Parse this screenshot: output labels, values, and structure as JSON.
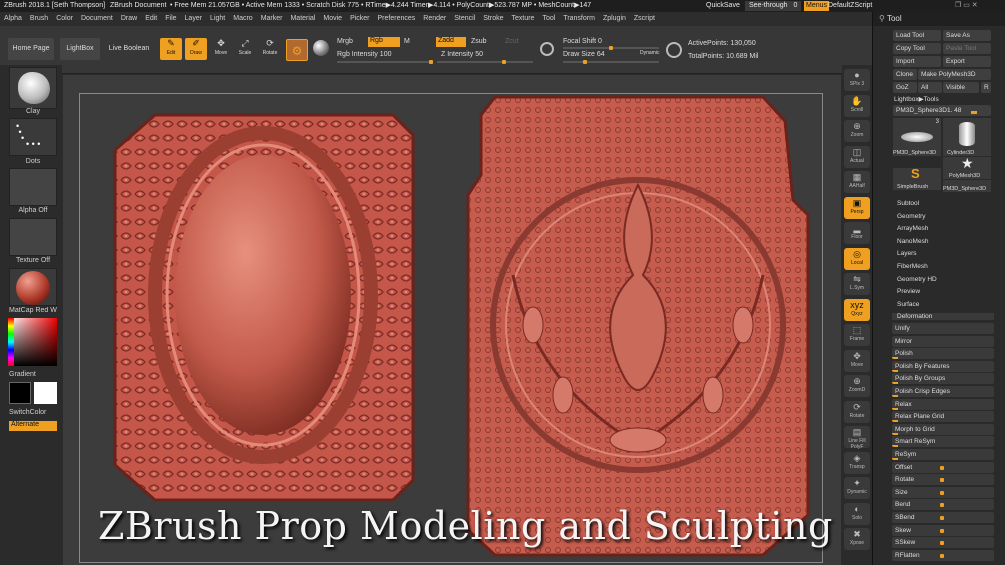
{
  "titlebar": {
    "app": "ZBrush 2018.1 [Seth Thompson]",
    "doc": "ZBrush Document",
    "stats": "• Free Mem 21.057GB • Active Mem 1333 • Scratch Disk 775 • RTime▶4.244 Timer▶4.114 • PolyCount▶523.787 MP • MeshCount▶147",
    "quicksave": "QuickSave",
    "seethrough": "See-through",
    "seethrough_value": "0",
    "menus": "Menus",
    "zscript": "DefaultZScript"
  },
  "menubar": [
    "Alpha",
    "Brush",
    "Color",
    "Document",
    "Draw",
    "Edit",
    "File",
    "Layer",
    "Light",
    "Macro",
    "Marker",
    "Material",
    "Movie",
    "Picker",
    "Preferences",
    "Render",
    "Stencil",
    "Stroke",
    "Texture",
    "Tool",
    "Transform",
    "Zplugin",
    "Zscript"
  ],
  "toolbar": {
    "home": "Home Page",
    "lightbox": "LightBox",
    "liveboolean": "Live Boolean",
    "edit": "Edit",
    "draw": "Draw",
    "move": "Move",
    "scale": "Scale",
    "rotate": "Rotate",
    "mrgb": "Mrgb",
    "rgb": "Rgb",
    "m": "M",
    "zadd": "Zadd",
    "zsub": "Zsub",
    "zcut": "Zcut",
    "rgb_intensity": "Rgb Intensity 100",
    "z_intensity": "Z Intensity 50",
    "focal_shift": "Focal Shift 0",
    "draw_size": "Draw Size 64",
    "dynamic": "Dynamic",
    "active_points": "ActivePoints: 130,050",
    "total_points": "TotalPoints: 10.689 Mil"
  },
  "leftshelf": {
    "clay": "Clay",
    "dots": "Dots",
    "alpha": "Alpha Off",
    "texture": "Texture Off",
    "matcap": "MatCap Red Wax",
    "gradient": "Gradient",
    "switchcolor": "SwitchColor",
    "alternate": "Alternate"
  },
  "rightshelf": [
    "SPix 3",
    "Scroll",
    "Zoom",
    "Actual",
    "AAHalf",
    "Persp",
    "Floor",
    "Local",
    "L.Sym",
    "Qxyz",
    "Frame",
    "Move",
    "ZoomD",
    "Rotate",
    "Line Fill PolyF",
    "Transp",
    "Dynamic",
    "Solo",
    "Xpose"
  ],
  "panel": {
    "title": "Tool",
    "load": "Load Tool",
    "saveas": "Save As",
    "copy": "Copy Tool",
    "paste": "Paste Tool",
    "import": "Import",
    "export": "Export",
    "clone": "Clone",
    "makepoly": "Make PolyMesh3D",
    "goz": "GoZ",
    "all": "All",
    "visible": "Visible",
    "r": "R",
    "lightbox_tools": "Lightbox▶Tools",
    "current_tool": "PM3D_Sphere3D1. 48",
    "thumbs": [
      "PM3D_Sphere3D",
      "Cylinder3D",
      "PolyMesh3D",
      "SimpleBrush",
      "PM3D_Sphere3D"
    ],
    "thumb_count": "3",
    "menus": [
      "Subtool",
      "Geometry",
      "ArrayMesh",
      "NanoMesh",
      "Layers",
      "FiberMesh",
      "Geometry HD",
      "Preview",
      "Surface",
      "Deformation"
    ],
    "deform": [
      "Unify",
      "Mirror",
      "Polish",
      "Polish By Features",
      "Polish By Groups",
      "Polish Crisp Edges",
      "Relax",
      "Relax Plane Grid",
      "Morph to Grid",
      "Smart ReSym",
      "ReSym",
      "Offset",
      "Rotate",
      "Size",
      "Bend",
      "SBend",
      "Skew",
      "SSkew",
      "RFlatten"
    ]
  },
  "banner": "ZBrush Prop Modeling and Sculpting",
  "colors": {
    "accent": "#f0a020",
    "clay": "#c9564b",
    "bg": "#3c3c3c"
  }
}
